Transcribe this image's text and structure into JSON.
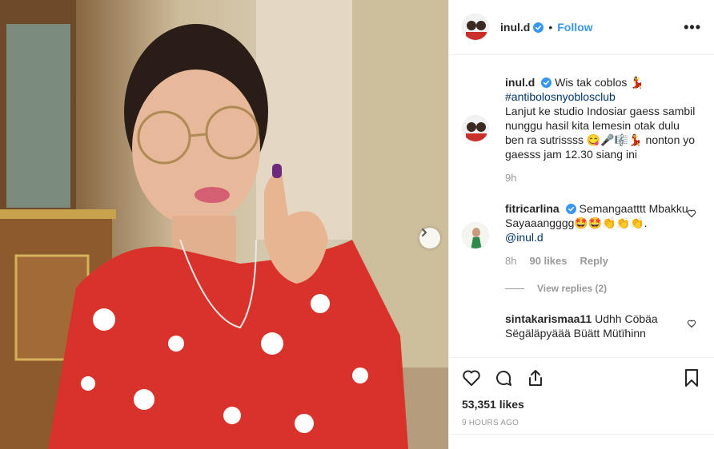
{
  "post": {
    "username": "inul.d",
    "follow_label": "Follow",
    "more_label": "•••",
    "separator": "•"
  },
  "comments": [
    {
      "username": "inul.d",
      "text_line1": "Wis tak coblos 💃",
      "hashtag": "#antibolosnyoblosclub",
      "text_rest": "Lanjut ke studio Indosiar gaess sambil nunggu hasil kita lemesin otak dulu ben ra sutrissss 😋🎤🎼💃 nonton yo gaesss jam 12.30 siang ini",
      "time": "9h"
    },
    {
      "username": "fitricarlina",
      "text_line1": "Semangaatttt Mbakku",
      "text_line2": "Sayaaangggg🤩🤩👏👏👏.",
      "mention": "@inul.d",
      "time": "8h",
      "likes": "90 likes",
      "reply_label": "Reply"
    },
    {
      "username": "sintakarismaa11",
      "text": "Udhh Cöbäa Sëgäläpyäää Büätt Mütïhinn"
    }
  ],
  "view_replies_label": "View replies (2)",
  "likes_count": "53,351 likes",
  "timestamp": "9 HOURS AGO",
  "colors": {
    "link": "#3897f0",
    "hashtag": "#003569",
    "muted": "#999999",
    "verified": "#3897f0"
  }
}
